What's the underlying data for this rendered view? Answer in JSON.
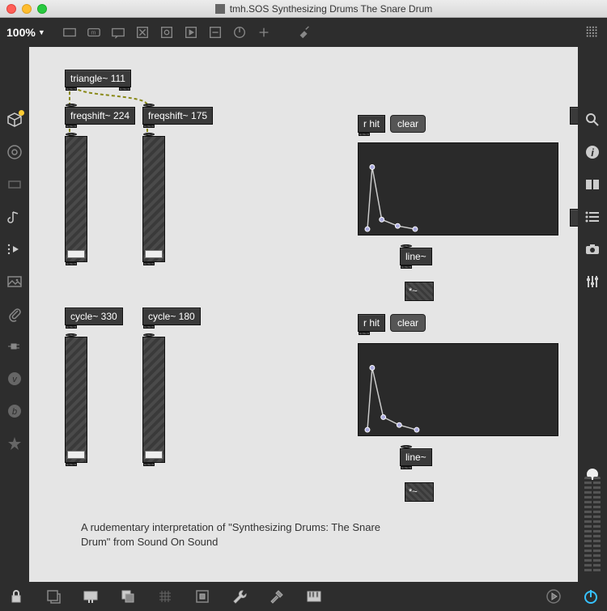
{
  "window": {
    "title": "tmh.SOS Synthesizing Drums The Snare Drum"
  },
  "toolbar": {
    "zoom": "100%"
  },
  "objects": {
    "triangle": "triangle~ 111",
    "freqshift1": "freqshift~ 224",
    "freqshift2": "freqshift~ 175",
    "rhit1": "r hit",
    "clear1": "clear",
    "line1": "line~",
    "mult1": "*~",
    "cycle1": "cycle~ 330",
    "cycle2": "cycle~ 180",
    "rhit2": "r hit",
    "clear2": "clear",
    "line2": "line~",
    "mult2": "*~"
  },
  "caption": {
    "line1": "A rudementary interpretation of \"Synthesizing Drums: The Snare",
    "line2": "Drum\" from Sound On Sound"
  }
}
